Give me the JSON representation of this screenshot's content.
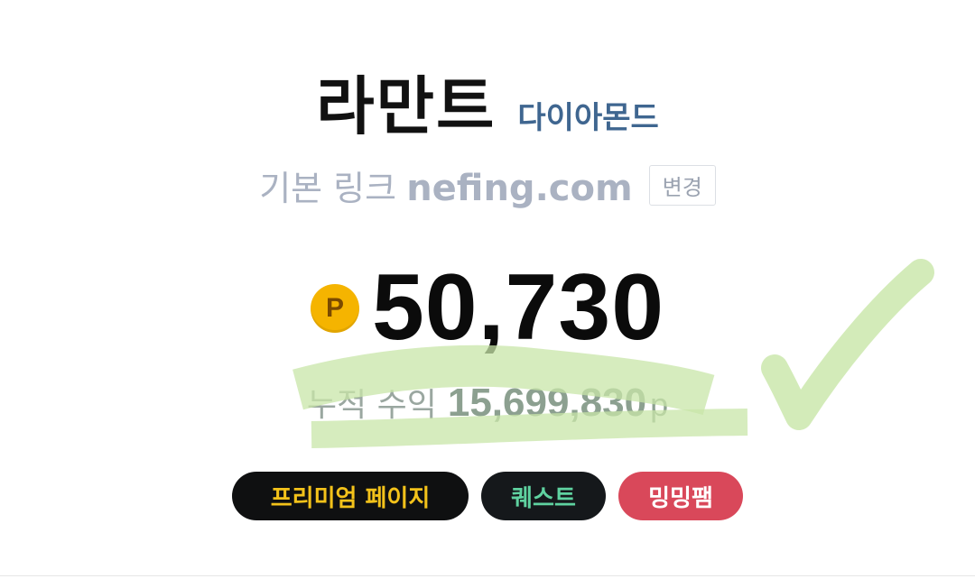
{
  "profile": {
    "name": "라만트",
    "grade": "다이아몬드"
  },
  "link": {
    "label": "기본 링크",
    "domain": "nefing.com",
    "change_label": "변경"
  },
  "points": {
    "icon_letter": "P",
    "value": "50,730"
  },
  "cumulative": {
    "label": "누적 수익",
    "value": "15,699,830",
    "unit": "p"
  },
  "buttons": {
    "premium": "프리미엄 페이지",
    "quest": "퀘스트",
    "mingming": "밍밍팸"
  },
  "colors": {
    "grade": "#3f6690",
    "coin": "#f5b400",
    "premium_text": "#f3c21a",
    "quest_text": "#5fd2a0",
    "mingming_bg": "#d9485a",
    "highlighter": "#c8e6a8"
  }
}
